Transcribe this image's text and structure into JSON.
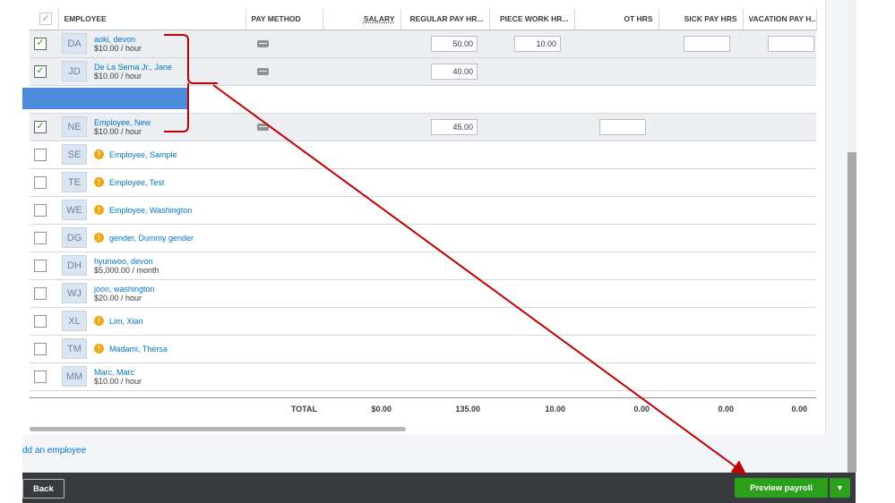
{
  "table": {
    "headers": {
      "employee": "EMPLOYEE",
      "pay_method": "PAY METHOD",
      "salary": "SALARY",
      "regular": "REGULAR PAY HR...",
      "piece": "PIECE WORK HR...",
      "ot": "OT HRS",
      "sick": "SICK PAY HRS",
      "vacation": "VACATION PAY H..."
    },
    "rows": [
      {
        "initials": "DA",
        "name": "aoki, devon",
        "rate": "$10.00 / hour",
        "checked": true,
        "regular": "50.00",
        "piece": "10.00"
      },
      {
        "initials": "JD",
        "name": "De La Serna Jr., Jane",
        "rate": "$10.00 / hour",
        "checked": true,
        "regular": "40.00"
      },
      {
        "initials": "NE",
        "name": "Employee, New",
        "rate": "$10.00 / hour",
        "checked": true,
        "regular": "45.00"
      },
      {
        "initials": "SE",
        "name": "Employee, Sample"
      },
      {
        "initials": "TE",
        "name": "Employee, Test"
      },
      {
        "initials": "WE",
        "name": "Employee, Washington"
      },
      {
        "initials": "DG",
        "name": "gender, Dummy gender"
      },
      {
        "initials": "DH",
        "name": "hyunwoo, devon",
        "rate": "$5,000.00 / month"
      },
      {
        "initials": "WJ",
        "name": "joon, washington",
        "rate": "$20.00 / hour"
      },
      {
        "initials": "XL",
        "name": "Lim, Xian"
      },
      {
        "initials": "TM",
        "name": "Madami, Thersa"
      },
      {
        "initials": "MM",
        "name": "Marc, Marc",
        "rate": "$10.00 / hour"
      }
    ],
    "totals": {
      "label": "TOTAL",
      "salary": "$0.00",
      "regular": "135.00",
      "piece": "10.00",
      "ot": "0.00",
      "sick": "0.00",
      "vacation": "0.00"
    }
  },
  "add_employee_link": "dd an employee",
  "footer": {
    "back_label": "Back",
    "preview_label": "Preview payroll"
  },
  "icons": {
    "checkbox": "check-icon",
    "warning": "warning-icon",
    "pay_method": "paycheck-icon",
    "dropdown": "caret-down-icon"
  },
  "colors": {
    "accent_green": "#2ca01c",
    "link_blue": "#0077c5",
    "annotation_red": "#c00000",
    "warning_orange": "#f0a615"
  }
}
